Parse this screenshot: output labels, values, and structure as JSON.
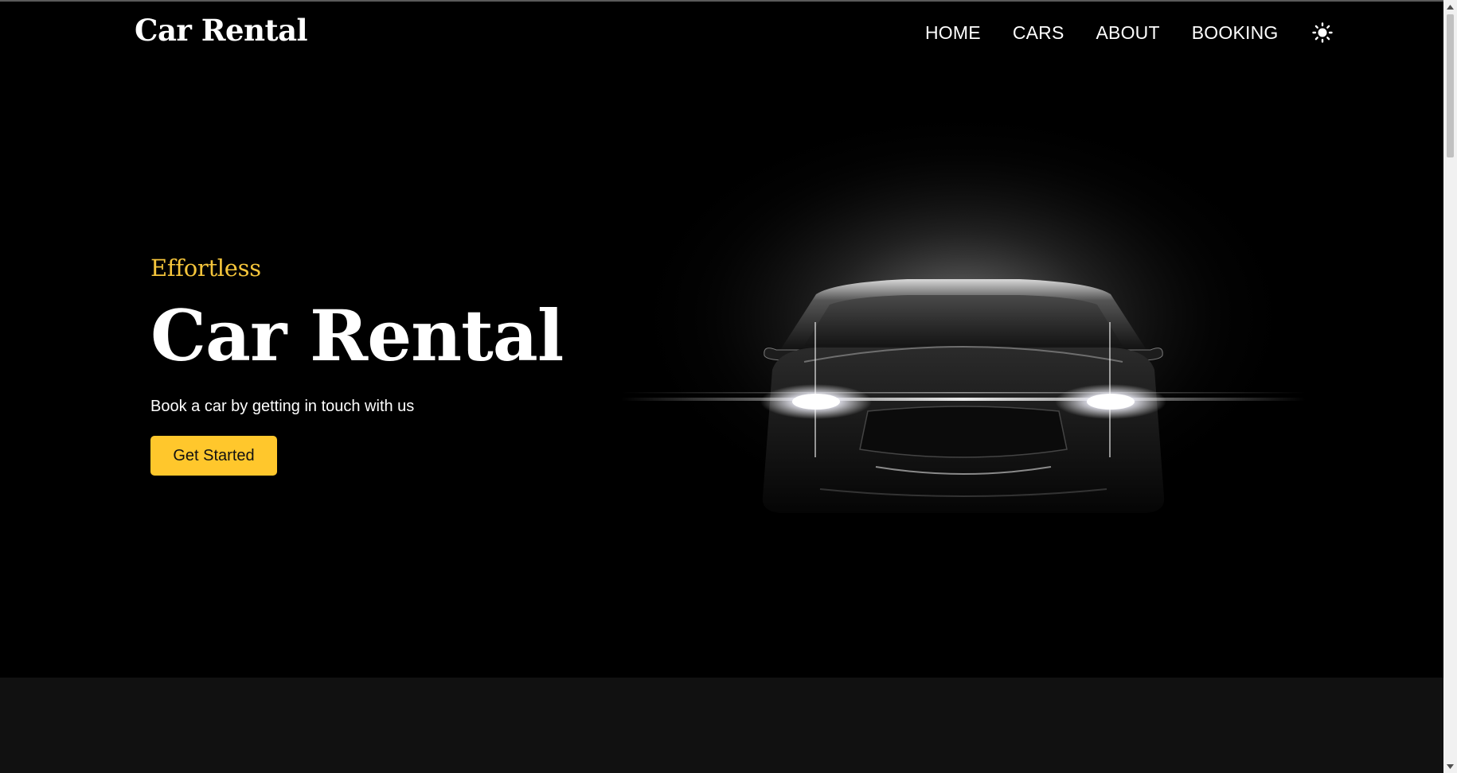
{
  "header": {
    "brand": "Car Rental",
    "nav": [
      {
        "label": "HOME"
      },
      {
        "label": "CARS"
      },
      {
        "label": "ABOUT"
      },
      {
        "label": "BOOKING"
      }
    ],
    "theme_icon": "sun-icon"
  },
  "hero": {
    "kicker": "Effortless",
    "title": "Car Rental",
    "subtitle": "Book a car by getting in touch with us",
    "cta": "Get Started",
    "image_icon": "car-headlights-illustration"
  },
  "colors": {
    "accent": "#ffc72c",
    "kicker": "#f5c53b",
    "background": "#000000",
    "lower_section": "#111111"
  }
}
